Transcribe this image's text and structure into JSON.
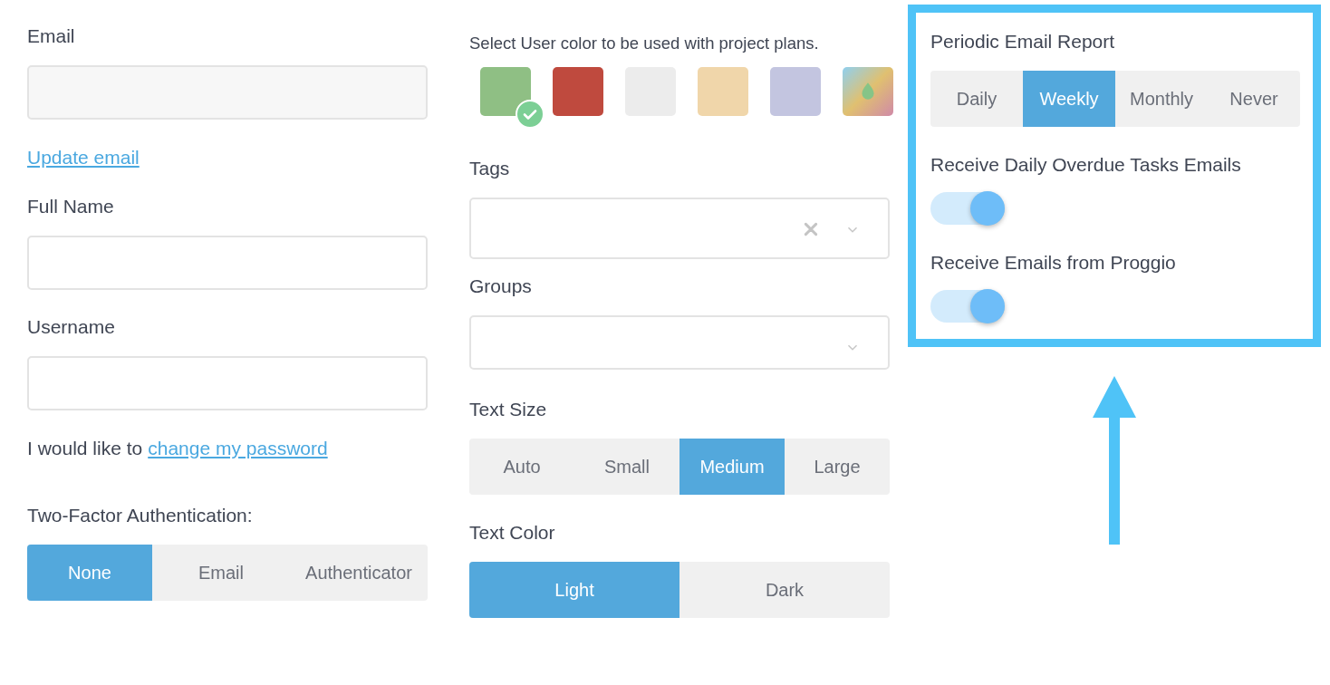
{
  "left": {
    "email_label": "Email",
    "update_email_link": "Update email",
    "full_name_label": "Full Name",
    "username_label": "Username",
    "password_prefix": "I would like to",
    "password_link": "change my password",
    "two_factor_label": "Two-Factor Authentication:",
    "two_factor_options": [
      {
        "label": "None",
        "selected": true
      },
      {
        "label": "Email",
        "selected": false
      },
      {
        "label": "Authenticator",
        "selected": false
      }
    ]
  },
  "middle": {
    "color_caption": "Select User color to be used with project plans.",
    "swatches": [
      {
        "kind": "solid",
        "color": "#8fbf84",
        "selected": true
      },
      {
        "kind": "solid",
        "color": "#bf4a3e",
        "selected": false
      },
      {
        "kind": "solid",
        "color": "#ececec",
        "selected": false
      },
      {
        "kind": "solid",
        "color": "#f0d6aa",
        "selected": false
      },
      {
        "kind": "solid",
        "color": "#c3c5e0",
        "selected": false
      },
      {
        "kind": "multicolor",
        "selected": false
      }
    ],
    "tags_label": "Tags",
    "groups_label": "Groups",
    "text_size_label": "Text Size",
    "text_size_options": [
      {
        "label": "Auto",
        "selected": false
      },
      {
        "label": "Small",
        "selected": false
      },
      {
        "label": "Medium",
        "selected": true
      },
      {
        "label": "Large",
        "selected": false
      }
    ],
    "text_color_label": "Text Color",
    "text_color_options": [
      {
        "label": "Light",
        "selected": true
      },
      {
        "label": "Dark",
        "selected": false
      }
    ]
  },
  "right": {
    "report_label": "Periodic Email Report",
    "report_options": [
      {
        "label": "Daily",
        "selected": false
      },
      {
        "label": "Weekly",
        "selected": true
      },
      {
        "label": "Monthly",
        "selected": false
      },
      {
        "label": "Never",
        "selected": false
      }
    ],
    "toggles": [
      {
        "label": "Receive Daily Overdue Tasks Emails",
        "on": true
      },
      {
        "label": "Receive Emails from Proggio",
        "on": true
      }
    ]
  }
}
